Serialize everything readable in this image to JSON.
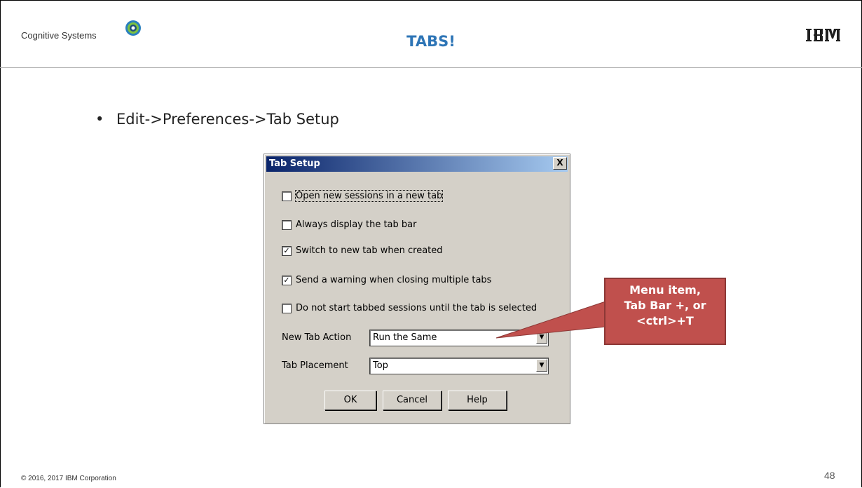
{
  "header": {
    "brand": "Cognitive Systems",
    "title": "TABS!",
    "ibm_logo": "IBM"
  },
  "bullet": {
    "text": "Edit->Preferences->Tab Setup"
  },
  "dialog": {
    "title": "Tab Setup",
    "close_label": "X",
    "checkboxes": [
      {
        "label": "Open new sessions in a new tab",
        "checked": false
      },
      {
        "label": "Always display the tab bar",
        "checked": false
      },
      {
        "label": "Switch to new tab when created",
        "checked": true
      },
      {
        "label": "Send a warning when closing multiple tabs",
        "checked": true
      },
      {
        "label": "Do not start tabbed sessions until the tab is selected",
        "checked": false
      }
    ],
    "new_tab_action": {
      "label": "New Tab Action",
      "value": "Run the Same"
    },
    "tab_placement": {
      "label": "Tab Placement",
      "value": "Top"
    },
    "buttons": {
      "ok": "OK",
      "cancel": "Cancel",
      "help": "Help"
    }
  },
  "callout": {
    "line1": "Menu item,",
    "line2": "Tab Bar +, or",
    "line3": "<ctrl>+T",
    "color": "#c0504d"
  },
  "footer": {
    "copyright": "© 2016, 2017 IBM Corporation",
    "page_number": "48"
  },
  "colors": {
    "title_blue": "#2e75b6",
    "dialog_bg": "#d4d0c8",
    "titlebar_start": "#0a246a",
    "titlebar_end": "#a6caf0"
  }
}
